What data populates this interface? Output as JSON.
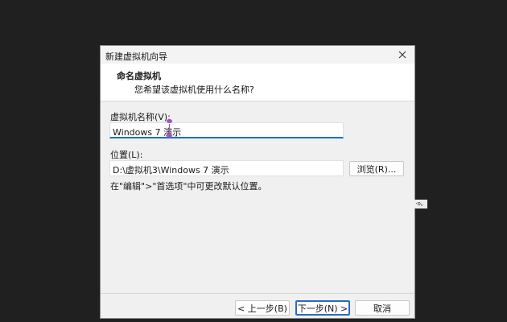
{
  "window": {
    "title": "新建虚拟机向导"
  },
  "header": {
    "title": "命名虚拟机",
    "subtitle": "您希望该虚拟机使用什么名称?"
  },
  "form": {
    "name_label": "虚拟机名称(V):",
    "name_value": "Windows 7 演示",
    "location_label": "位置(L):",
    "location_value": "D:\\虚拟机3\\Windows 7 演示",
    "browse_label": "浏览(R)...",
    "hint": "在\"编辑\">\"首选项\"中可更改默认位置。"
  },
  "footer": {
    "back_label": "< 上一步(B)",
    "next_label": "下一步(N) >",
    "cancel_label": "取消"
  },
  "side_fragment": "·o。",
  "colors": {
    "background": "#202020",
    "dialog": "#f0f0f0",
    "accent": "#2a68c0",
    "caret": "#a24fd6"
  },
  "icons": {
    "close": "close-icon"
  }
}
